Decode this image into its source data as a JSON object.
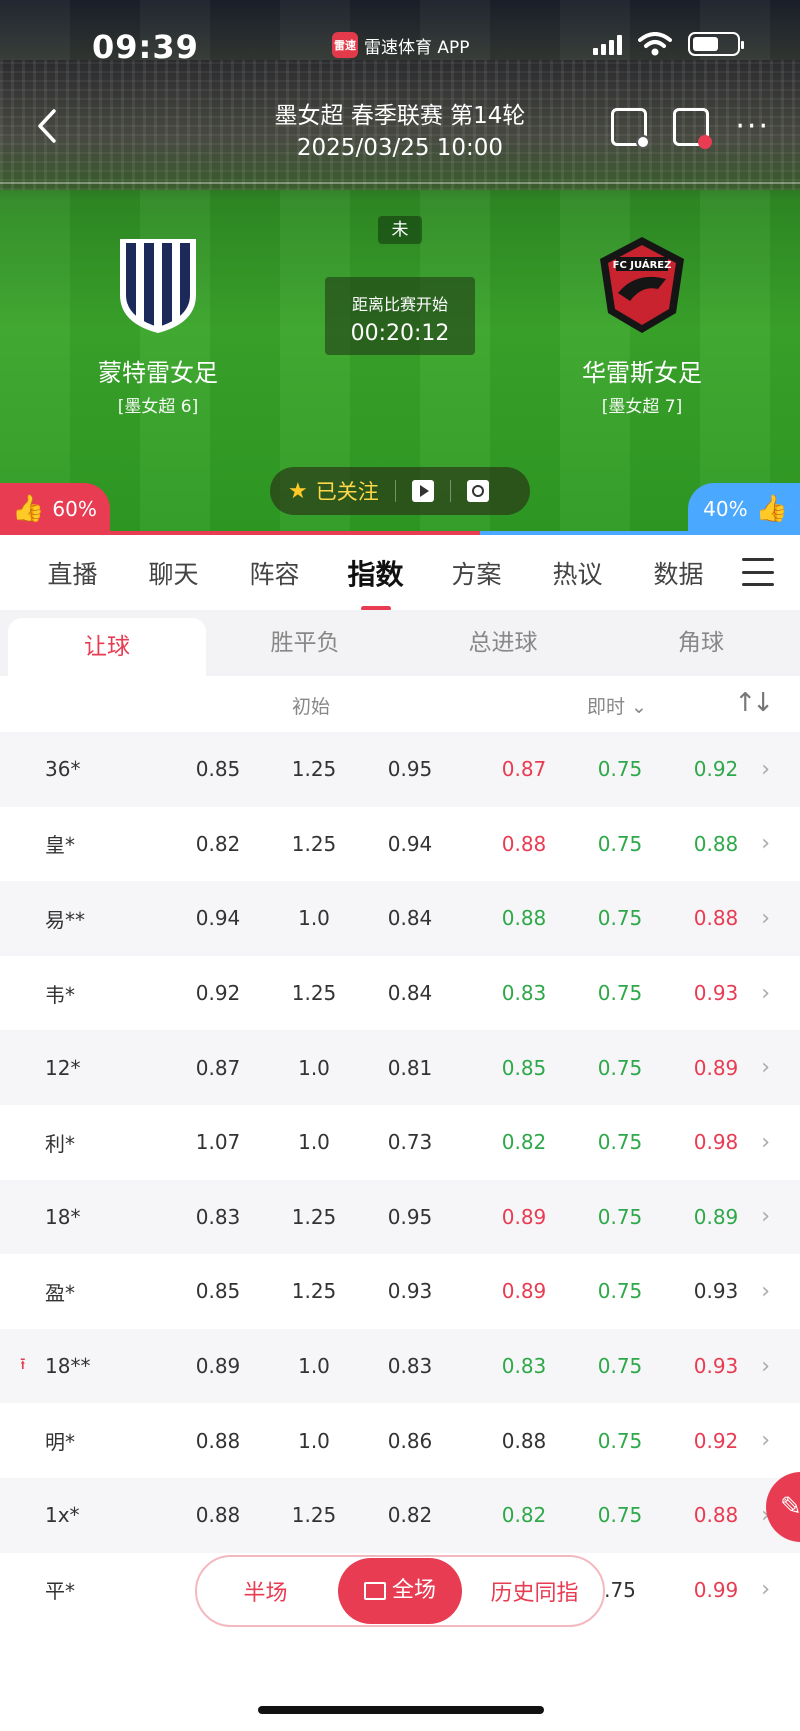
{
  "status": {
    "time": "09:39",
    "brand_name": "雷速体育 APP",
    "brand_logo_text": "雷速"
  },
  "header": {
    "title": "墨女超 春季联赛 第14轮",
    "datetime": "2025/03/25 10:00"
  },
  "match": {
    "state": "未",
    "countdown_label": "距离比赛开始",
    "countdown_value": "00:20:12",
    "home": {
      "name": "蒙特雷女足",
      "rank": "[墨女超 6]"
    },
    "away": {
      "name": "华雷斯女足",
      "rank": "[墨女超 7]"
    },
    "follow_label": "已关注"
  },
  "vote": {
    "home_pct": "60%",
    "away_pct": "40%",
    "home_fraction": 0.6
  },
  "tabs": [
    "直播",
    "聊天",
    "阵容",
    "指数",
    "方案",
    "热议",
    "数据"
  ],
  "active_tab": 3,
  "subtabs": [
    "让球",
    "胜平负",
    "总进球",
    "角球"
  ],
  "columns": {
    "initial": "初始",
    "live": "即时 ⌄"
  },
  "rows": [
    {
      "company": "36*",
      "i1": "0.85",
      "i2": "1.25",
      "i3": "0.95",
      "l1": "0.87",
      "l2": "0.75",
      "l3": "0.92",
      "c1": "red",
      "c2": "green",
      "c3": "green"
    },
    {
      "company": "皇*",
      "i1": "0.82",
      "i2": "1.25",
      "i3": "0.94",
      "l1": "0.88",
      "l2": "0.75",
      "l3": "0.88",
      "c1": "red",
      "c2": "green",
      "c3": "green"
    },
    {
      "company": "易**",
      "i1": "0.94",
      "i2": "1.0",
      "i3": "0.84",
      "l1": "0.88",
      "l2": "0.75",
      "l3": "0.88",
      "c1": "green",
      "c2": "green",
      "c3": "red"
    },
    {
      "company": "韦*",
      "i1": "0.92",
      "i2": "1.25",
      "i3": "0.84",
      "l1": "0.83",
      "l2": "0.75",
      "l3": "0.93",
      "c1": "green",
      "c2": "green",
      "c3": "red"
    },
    {
      "company": "12*",
      "i1": "0.87",
      "i2": "1.0",
      "i3": "0.81",
      "l1": "0.85",
      "l2": "0.75",
      "l3": "0.89",
      "c1": "green",
      "c2": "green",
      "c3": "red"
    },
    {
      "company": "利*",
      "i1": "1.07",
      "i2": "1.0",
      "i3": "0.73",
      "l1": "0.82",
      "l2": "0.75",
      "l3": "0.98",
      "c1": "green",
      "c2": "green",
      "c3": "red"
    },
    {
      "company": "18*",
      "i1": "0.83",
      "i2": "1.25",
      "i3": "0.95",
      "l1": "0.89",
      "l2": "0.75",
      "l3": "0.89",
      "c1": "red",
      "c2": "green",
      "c3": "green"
    },
    {
      "company": "盈*",
      "i1": "0.85",
      "i2": "1.25",
      "i3": "0.93",
      "l1": "0.89",
      "l2": "0.75",
      "l3": "0.93",
      "c1": "red",
      "c2": "green",
      "c3": "black"
    },
    {
      "company": "18**",
      "i1": "0.89",
      "i2": "1.0",
      "i3": "0.83",
      "l1": "0.83",
      "l2": "0.75",
      "l3": "0.93",
      "c1": "green",
      "c2": "green",
      "c3": "red",
      "up": true
    },
    {
      "company": "明*",
      "i1": "0.88",
      "i2": "1.0",
      "i3": "0.86",
      "l1": "0.88",
      "l2": "0.75",
      "l3": "0.92",
      "c1": "black",
      "c2": "green",
      "c3": "red"
    },
    {
      "company": "1x*",
      "i1": "0.88",
      "i2": "1.25",
      "i3": "0.82",
      "l1": "0.82",
      "l2": "0.75",
      "l3": "0.88",
      "c1": "green",
      "c2": "green",
      "c3": "red"
    },
    {
      "company": "平*",
      "i1": "",
      "i2": "",
      "i3": "",
      "l1": "",
      "l2": ".75",
      "l3": "0.99",
      "c1": "green",
      "c2": "black",
      "c3": "red"
    }
  ],
  "bottom_switch": [
    "半场",
    "全场",
    "历史同指"
  ],
  "colors": {
    "accent": "#e83c52",
    "green": "#2fa84a",
    "away_blue": "#4aa8ff"
  }
}
